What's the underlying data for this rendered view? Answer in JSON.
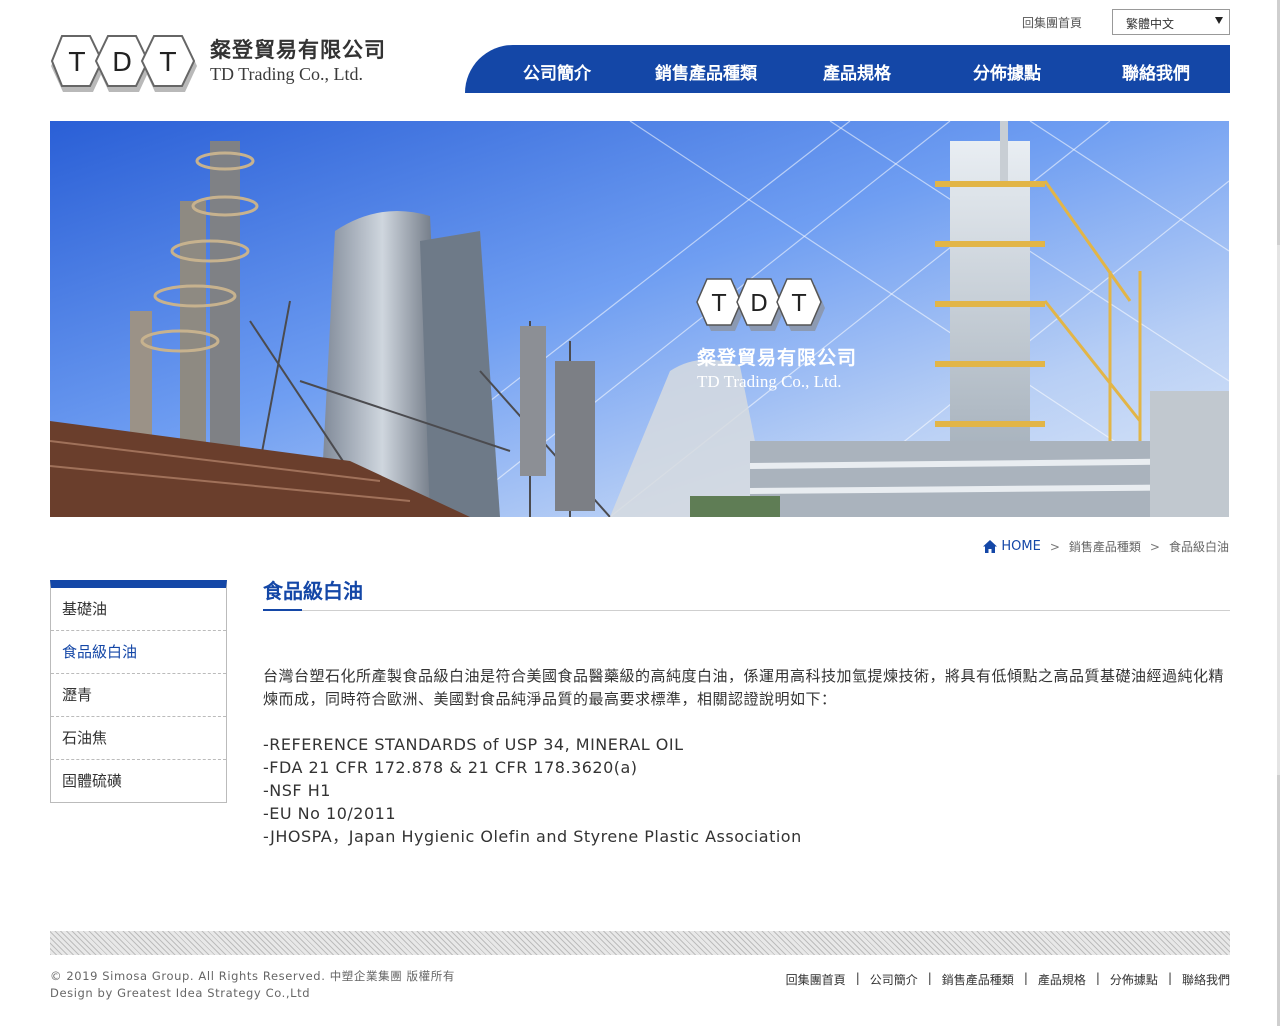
{
  "header": {
    "company_cn": "粲登貿易有限公司",
    "company_en": "TD Trading Co., Ltd.",
    "logo_letters": [
      "T",
      "D",
      "T"
    ],
    "group_home": "回集團首頁",
    "language_selected": "繁體中文"
  },
  "nav": {
    "items": [
      "公司簡介",
      "銷售產品種類",
      "產品規格",
      "分佈據點",
      "聯絡我們"
    ]
  },
  "banner": {
    "company_cn": "粲登貿易有限公司",
    "company_en": "TD Trading Co., Ltd."
  },
  "breadcrumb": {
    "home": "HOME",
    "category": "銷售產品種類",
    "current": "食品級白油",
    "separator": ">"
  },
  "sidebar": {
    "items": [
      "基礎油",
      "食品級白油",
      "瀝青",
      "石油焦",
      "固體硫磺"
    ],
    "active_index": 1
  },
  "content": {
    "title": "食品級白油",
    "paragraph": "台灣台塑石化所產製食品級白油是符合美國食品醫藥級的高純度白油，係運用高科技加氫提煉技術，將具有低傾點之高品質基礎油經過純化精煉而成，同時符合歐洲、美國對食品純淨品質的最高要求標準，相關認證說明如下：",
    "standards": [
      "-REFERENCE STANDARDS of USP 34, MINERAL OIL",
      "-FDA 21 CFR 172.878 & 21 CFR 178.3620(a)",
      "-NSF H1",
      "-EU No 10/2011",
      "-JHOSPA，Japan Hygienic Olefin and Styrene Plastic Association"
    ]
  },
  "footer": {
    "copyright": "© 2019 Simosa Group. All Rights Reserved. 中塑企業集團 版權所有",
    "design": "Design by Greatest Idea Strategy Co.,Ltd",
    "links": [
      "回集團首頁",
      "公司簡介",
      "銷售產品種類",
      "產品規格",
      "分佈據點",
      "聯絡我們"
    ],
    "separator": "|"
  },
  "colors": {
    "brand_blue": "#1447a7",
    "text": "#333333"
  }
}
